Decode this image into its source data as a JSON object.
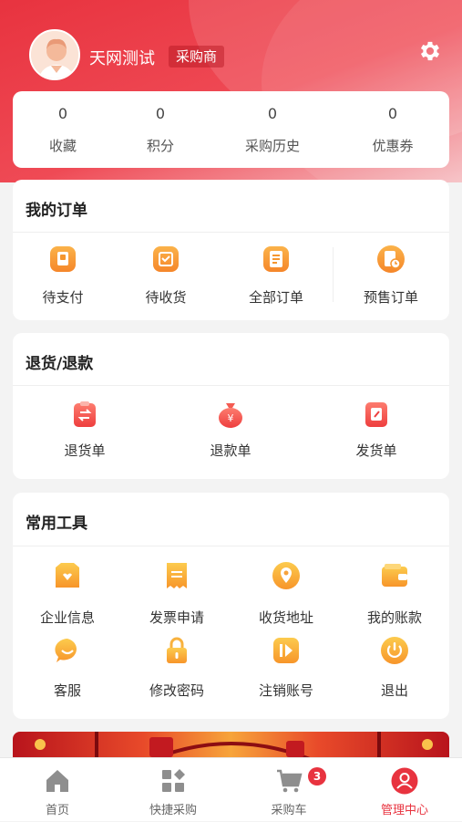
{
  "profile": {
    "username": "天网测试",
    "role": "采购商"
  },
  "stats": [
    {
      "value": "0",
      "label": "收藏"
    },
    {
      "value": "0",
      "label": "积分"
    },
    {
      "value": "0",
      "label": "采购历史"
    },
    {
      "value": "0",
      "label": "优惠券"
    }
  ],
  "orders": {
    "title": "我的订单",
    "items": [
      {
        "label": "待支付",
        "icon": "wallet-icon"
      },
      {
        "label": "待收货",
        "icon": "box-icon"
      },
      {
        "label": "全部订单",
        "icon": "document-icon"
      },
      {
        "label": "预售订单",
        "icon": "clipboard-clock-icon"
      }
    ]
  },
  "returns": {
    "title": "退货/退款",
    "items": [
      {
        "label": "退货单",
        "icon": "return-icon"
      },
      {
        "label": "退款单",
        "icon": "money-bag-icon"
      },
      {
        "label": "发货单",
        "icon": "shipping-note-icon"
      }
    ]
  },
  "tools": {
    "title": "常用工具",
    "items": [
      {
        "label": "企业信息",
        "icon": "shop-icon"
      },
      {
        "label": "发票申请",
        "icon": "invoice-icon"
      },
      {
        "label": "收货地址",
        "icon": "location-icon"
      },
      {
        "label": "我的账款",
        "icon": "wallet-card-icon"
      },
      {
        "label": "客服",
        "icon": "chat-icon"
      },
      {
        "label": "修改密码",
        "icon": "lock-icon"
      },
      {
        "label": "注销账号",
        "icon": "cancel-account-icon"
      },
      {
        "label": "退出",
        "icon": "power-icon"
      }
    ]
  },
  "tabbar": {
    "items": [
      {
        "label": "首页",
        "icon": "home-icon"
      },
      {
        "label": "快捷采购",
        "icon": "grid-icon"
      },
      {
        "label": "采购车",
        "icon": "cart-icon"
      },
      {
        "label": "管理中心",
        "icon": "user-icon"
      }
    ],
    "cart_badge": "3",
    "active_color": "#e8333f"
  },
  "colors": {
    "brand_red": "#e8333f",
    "icon_orange": "#f7a23a",
    "icon_red": "#ef5350"
  }
}
